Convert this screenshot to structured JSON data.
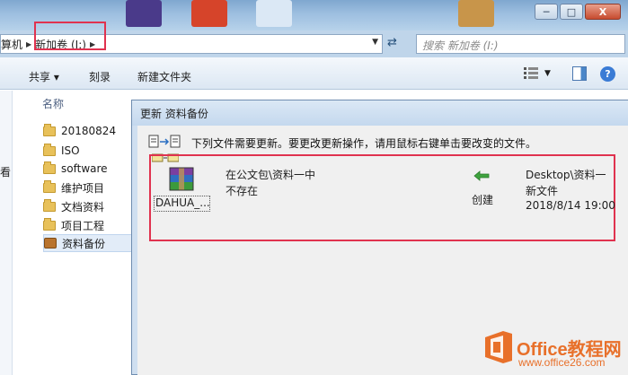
{
  "titlebar": {
    "window_buttons": [
      "minimize",
      "maximize",
      "close"
    ],
    "close_glyph": "X"
  },
  "address": {
    "crumb_prefix": "算机",
    "crumb_current": "新加卷 (I:)",
    "search_placeholder": "搜索 新加卷 (I:)"
  },
  "toolbar": {
    "share_label": "共享 ▾",
    "burn_label": "刻录",
    "new_folder_label": "新建文件夹"
  },
  "leftnav": {
    "partial_char": "看"
  },
  "filelist": {
    "column_name": "名称",
    "items": [
      {
        "label": "20180824",
        "icon": "folder-icon"
      },
      {
        "label": "ISO",
        "icon": "folder-icon"
      },
      {
        "label": "software",
        "icon": "folder-icon"
      },
      {
        "label": "维护项目",
        "icon": "folder-icon"
      },
      {
        "label": "文档资料",
        "icon": "folder-icon"
      },
      {
        "label": "项目工程",
        "icon": "folder-icon"
      },
      {
        "label": "资料备份",
        "icon": "briefcase-icon",
        "selected": true
      }
    ]
  },
  "dialog": {
    "title": "更新 资料备份",
    "instruction": "下列文件需要更新。要更改更新操作，请用鼠标右键单击要改变的文件。",
    "file": {
      "name": "DAHUA_...",
      "source_path": "在公文包\\资料一中",
      "source_status": "不存在",
      "action": "创建",
      "dest_path": "Desktop\\资料一",
      "dest_status": "新文件",
      "dest_time": "2018/8/14 19:00"
    }
  },
  "watermark": {
    "brand": "Office教程网",
    "url": "www.office26.com"
  },
  "colors": {
    "highlight_red": "#e0324f",
    "watermark_orange": "#e8702a",
    "titlebar_blue": "#9dbfe0"
  }
}
